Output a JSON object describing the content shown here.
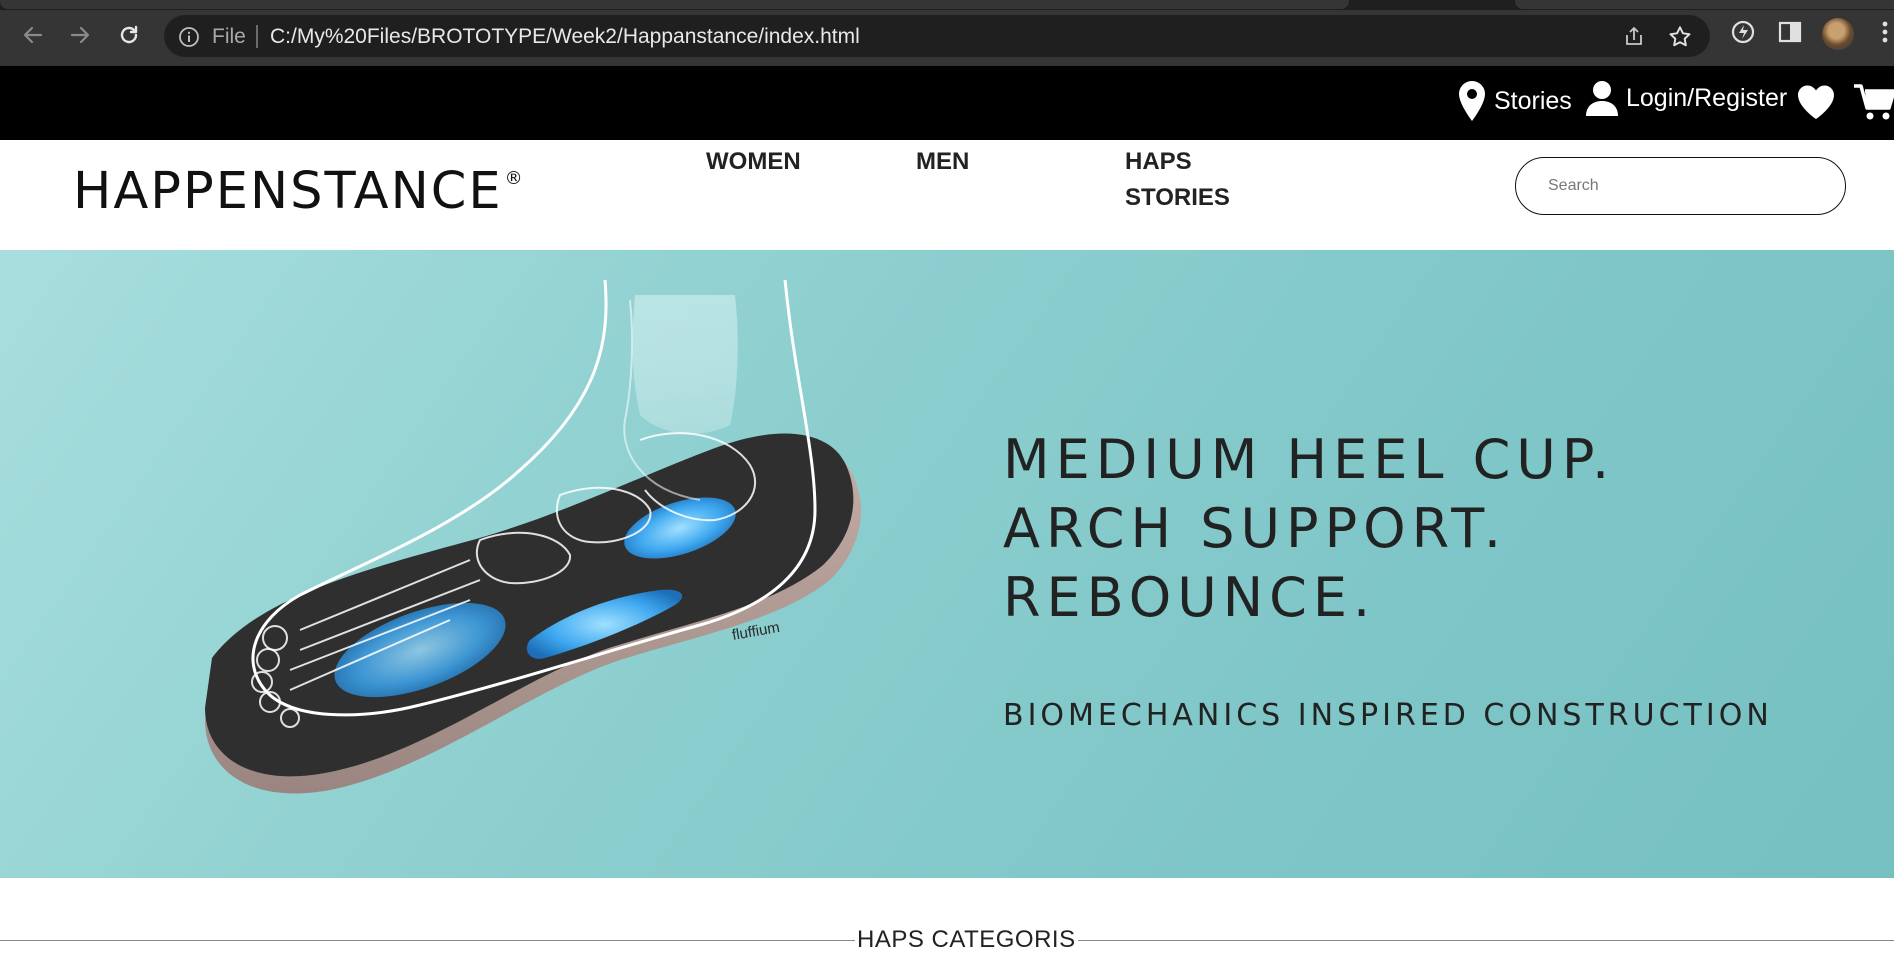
{
  "browser": {
    "scheme_label": "File",
    "url": "C:/My%20Files/BROTOTYPE/Week2/Happanstance/index.html",
    "icons": [
      "back-arrow-icon",
      "forward-arrow-icon",
      "reload-icon",
      "info-icon",
      "share-icon",
      "star-icon",
      "extensions-icon",
      "side-panel-icon",
      "profile-avatar",
      "menu-icon"
    ]
  },
  "topbar": {
    "stories_label": "Stories",
    "login_label": "Login/Register",
    "icons": [
      "location-pin-icon",
      "user-icon",
      "heart-icon",
      "cart-icon"
    ]
  },
  "header": {
    "logo_text": "HAPPENSTANCE",
    "logo_mark": "®",
    "nav": {
      "women": "WOMEN",
      "men": "MEN",
      "haps_line1": "HAPS",
      "haps_line2": "STORIES"
    },
    "search_placeholder": "Search"
  },
  "hero": {
    "line1": "MEDIUM HEEL CUP.",
    "line2": "ARCH SUPPORT.",
    "line3": "REBOUNCE.",
    "subtitle": "BIOMECHANICS INSPIRED CONSTRUCTION",
    "insole_brand": "fluffium",
    "colors": {
      "background": "#8fd0d0",
      "text": "#222222",
      "sole": "#b09a92",
      "footbed": "#2e2e2e",
      "cushion": "#3fa8f0"
    }
  },
  "section": {
    "title": "HAPS CATEGORIS"
  }
}
